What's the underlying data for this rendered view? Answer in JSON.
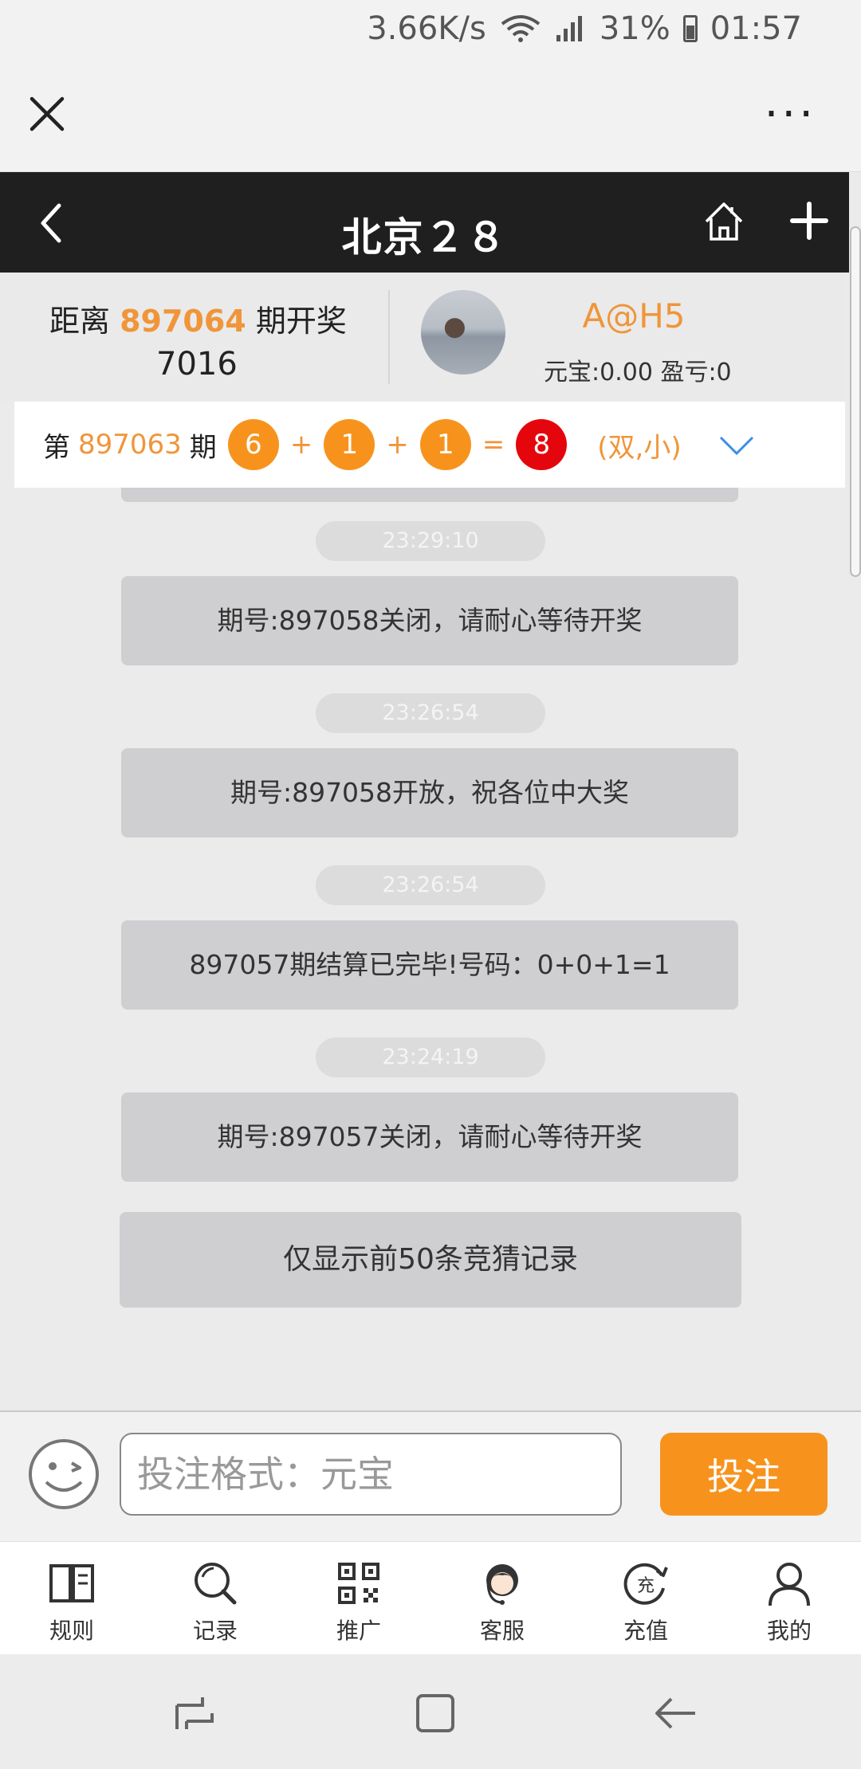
{
  "status_bar": {
    "speed": "3.66K/s",
    "battery": "31%",
    "time": "01:57"
  },
  "browser": {
    "more_label": "···"
  },
  "header": {
    "title": "北京２８"
  },
  "info": {
    "countdown_prefix": "距离",
    "next_issue": "897064",
    "countdown_suffix": "期开奖",
    "countdown_value": "7016",
    "username": "A@H5",
    "balance_text": "元宝:0.00 盈亏:0"
  },
  "last_result": {
    "prefix": "第",
    "issue": "897063",
    "suffix": "期",
    "balls": [
      "6",
      "1",
      "1"
    ],
    "plus": "+",
    "equals": "=",
    "sum": "8",
    "parity": "(双,小)"
  },
  "chat": {
    "messages": [
      {
        "time": "23:29:10",
        "text": "期号:897058关闭，请耐心等待开奖"
      },
      {
        "time": "23:26:54",
        "text": "期号:897058开放，祝各位中大奖"
      },
      {
        "time": "23:26:54",
        "text": "897057期结算已完毕!号码：0+0+1=1"
      },
      {
        "time": "23:24:19",
        "text": "期号:897057关闭，请耐心等待开奖"
      }
    ],
    "note": "仅显示前50条竞猜记录"
  },
  "input_bar": {
    "placeholder": "投注格式：元宝",
    "submit_label": "投注"
  },
  "nav": {
    "items": [
      {
        "label": "规则",
        "icon": "book-icon"
      },
      {
        "label": "记录",
        "icon": "search-icon"
      },
      {
        "label": "推广",
        "icon": "qr-code-icon"
      },
      {
        "label": "客服",
        "icon": "customer-service-icon"
      },
      {
        "label": "充值",
        "icon": "recharge-icon"
      },
      {
        "label": "我的",
        "icon": "user-icon"
      }
    ]
  },
  "colors": {
    "accent": "#f7931d",
    "header_bg": "#1f1f1f",
    "red_ball": "#e5060d"
  }
}
